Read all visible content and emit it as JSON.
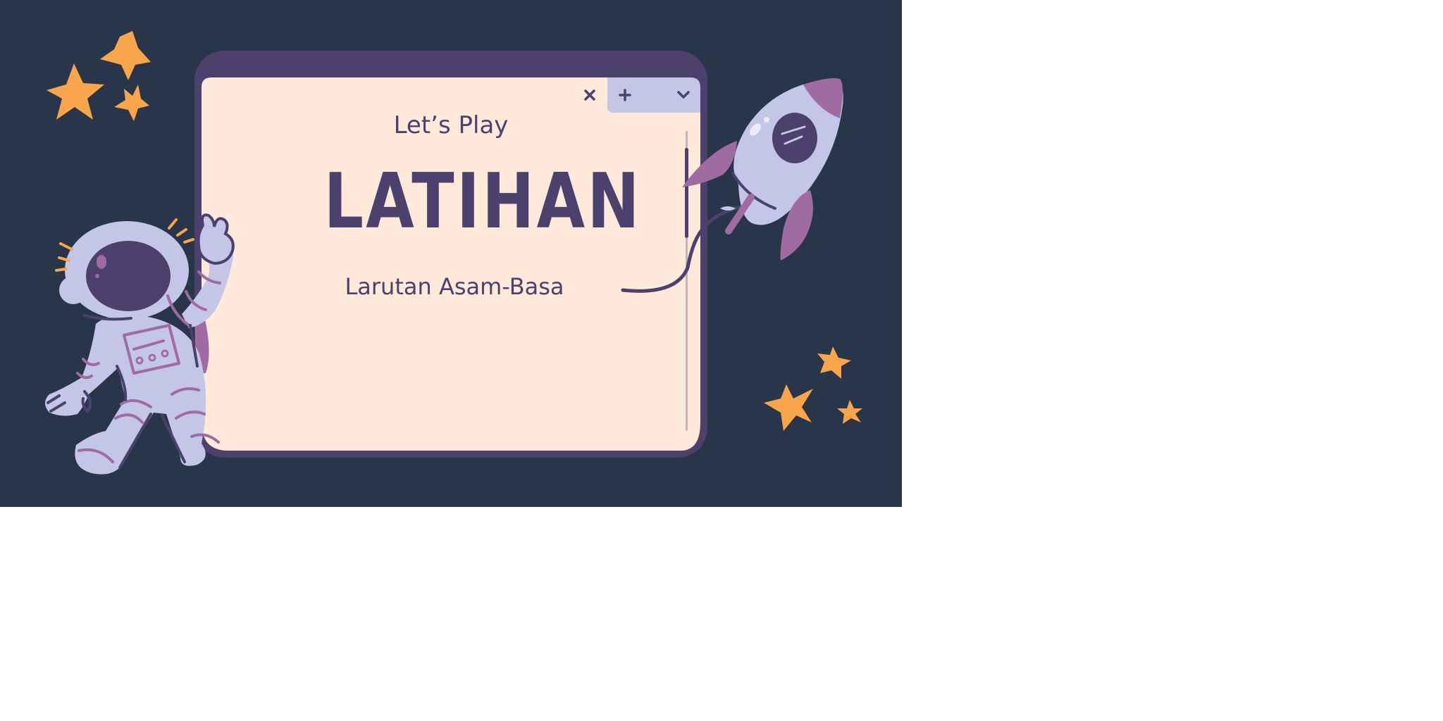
{
  "window": {
    "eyebrow": "Let’s Play",
    "title": "LATIHAN",
    "subtitle": "Larutan Asam-Basa",
    "controls": {
      "close_icon": "close-icon",
      "add_icon": "plus-icon",
      "menu_icon": "chevron-down-icon"
    }
  },
  "colors": {
    "background": "#293548",
    "window_frame": "#4b416c",
    "window_body": "#ffe9da",
    "tab": "#c3c6e6",
    "accent_purple": "#a06ba3",
    "star": "#f8a54b",
    "astronaut": "#c3c6e6"
  },
  "decorations": [
    "star-cluster-top-left",
    "astronaut-illustration",
    "rocket-illustration",
    "star-cluster-bottom-right"
  ]
}
